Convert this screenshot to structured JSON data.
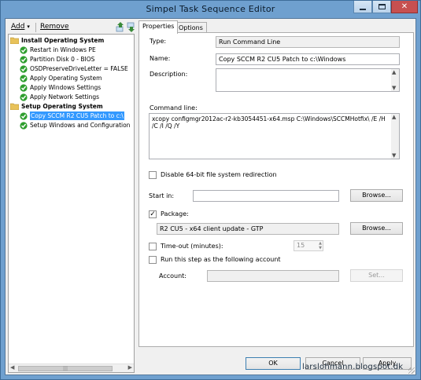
{
  "window": {
    "title": "Simpel Task Sequence Editor",
    "controls": [
      "minimize",
      "maximize",
      "close"
    ]
  },
  "toolbar": {
    "add_label": "Add",
    "add_arrow": "▾",
    "remove_label": "Remove"
  },
  "tree": {
    "groups": [
      {
        "label": "Install Operating System",
        "items": [
          "Restart in Windows PE",
          "Partition Disk 0 - BIOS",
          "OSDPreserveDriveLetter = FALSE",
          "Apply Operating System",
          "Apply Windows Settings",
          "Apply Network Settings"
        ]
      },
      {
        "label": "Setup Operating System",
        "items": [
          "Copy SCCM R2 CU5 Patch to c:\\",
          "Setup Windows and Configuration"
        ]
      }
    ],
    "selected": "Copy SCCM R2 CU5 Patch to c:\\"
  },
  "tabs": [
    "Properties",
    "Options"
  ],
  "properties": {
    "type_label": "Type:",
    "type_value": "Run Command Line",
    "name_label": "Name:",
    "name_value": "Copy SCCM R2 CU5 Patch to c:\\Windows",
    "description_label": "Description:",
    "description_value": "",
    "command_line_label": "Command line:",
    "command_line_value": "xcopy configmgr2012ac-r2-kb3054451-x64.msp C:\\Windows\\SCCMHotfix\\ /E /H /C /I /Q /Y",
    "disable_64bit_label": "Disable 64-bit file system redirection",
    "disable_64bit_checked": false,
    "start_in_label": "Start in:",
    "start_in_value": "",
    "browse_label": "Browse...",
    "package_label": "Package:",
    "package_checked": true,
    "package_value": "R2 CU5 - x64 client update - GTP",
    "timeout_label": "Time-out (minutes):",
    "timeout_checked": false,
    "timeout_value": "15",
    "run_as_label": "Run this step as the following account",
    "run_as_checked": false,
    "account_label": "Account:",
    "account_value": "",
    "set_label": "Set..."
  },
  "footer": {
    "ok_label": "OK",
    "cancel_label": "Cancel",
    "apply_label": "Apply"
  },
  "watermark": "larslohmann.blogspot.dk",
  "colors": {
    "frame": "#6fa0cf",
    "close_button": "#c75050",
    "selection": "#3399ff",
    "check_green": "#2e9e2e",
    "folder": "#e8c25a"
  }
}
